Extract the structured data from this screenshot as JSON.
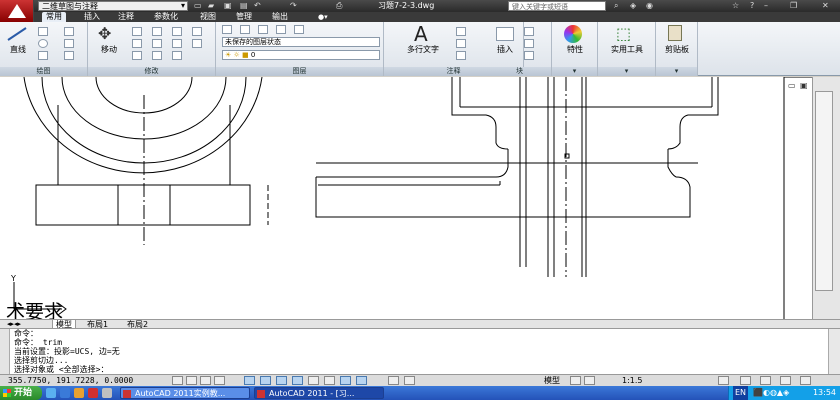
{
  "window": {
    "workspace": "二维草图与注释",
    "doc_title": "习题7-2-3.dwg",
    "search_placeholder": "键入关键字或短语"
  },
  "ribbon_tabs": [
    {
      "label": "常用",
      "active": true
    },
    {
      "label": "插入"
    },
    {
      "label": "注释"
    },
    {
      "label": "参数化"
    },
    {
      "label": "视图"
    },
    {
      "label": "管理"
    },
    {
      "label": "输出"
    }
  ],
  "panels": {
    "draw": {
      "title": "绘图",
      "line_label": "直线"
    },
    "modify": {
      "title": "修改",
      "move_label": "移动"
    },
    "layers": {
      "title": "图层",
      "state": "未保存的图层状态",
      "current_layer": "0"
    },
    "annotation": {
      "title": "注释",
      "mtext_label": "多行文字"
    },
    "block": {
      "title": "块",
      "insert_label": "插入"
    },
    "properties": {
      "label": "特性"
    },
    "utilities": {
      "label": "实用工具"
    },
    "clipboard": {
      "label": "剪贴板"
    }
  },
  "canvas": {
    "ucs_label": "Y",
    "big_text": "术要求"
  },
  "layout_tabs": [
    "模型",
    "布局1",
    "布局2"
  ],
  "command_lines": [
    "命令：",
    "命令：  trim",
    "当前设置：投影=UCS, 边=无",
    "选择剪切边...",
    "选择对象或 <全部选择>："
  ],
  "status": {
    "coords": "355.7750, 191.7228, 0.0000",
    "model_label": "模型",
    "scale": "1:1.5"
  },
  "taskbar": {
    "start": "开始",
    "tasks": [
      {
        "label": "AutoCAD 2011实例教...",
        "active": false
      },
      {
        "label": "AutoCAD 2011 - [习...",
        "active": true
      }
    ],
    "lang": "EN",
    "clock": "13:54"
  }
}
